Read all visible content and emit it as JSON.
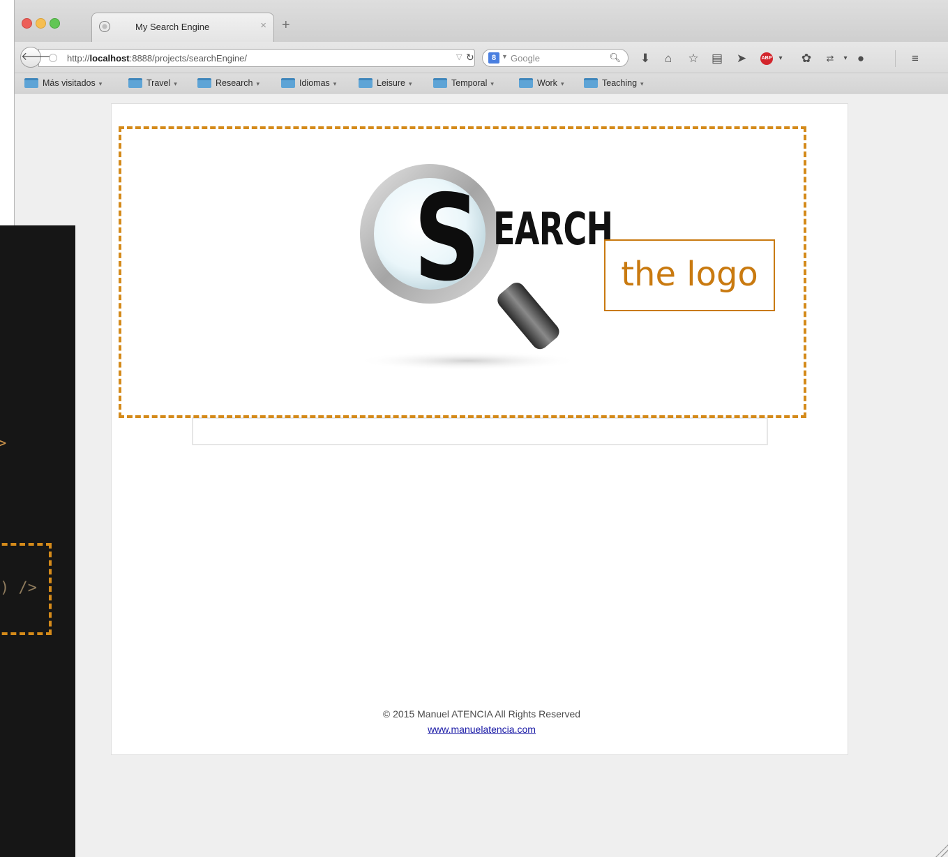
{
  "browser": {
    "tab_title": "My Search Engine",
    "tab_close": "×",
    "new_tab": "+",
    "url_prefix": "http://",
    "url_host": "localhost",
    "url_path": ":8888/projects/searchEngine/",
    "search_engine": "Google",
    "bookmarks": [
      {
        "label": "Más visitados"
      },
      {
        "label": "Travel"
      },
      {
        "label": "Research"
      },
      {
        "label": "Idiomas"
      },
      {
        "label": "Leisure"
      },
      {
        "label": "Temporal"
      },
      {
        "label": "Work"
      },
      {
        "label": "Teaching"
      }
    ]
  },
  "page": {
    "logo_text": "EARCH",
    "logo_initial": "S",
    "callout_label": "the logo",
    "search_query": "",
    "footer_copyright": "© 2015 Manuel ATENCIA All Rights Reserved",
    "footer_link": "www.manuelatencia.com"
  },
  "editor": {
    "fragment_top": ">",
    "fragment_tag": ") />"
  },
  "colors": {
    "annotation_orange": "#d48a1a",
    "editor_bg": "#161616",
    "page_bg": "#ffffff",
    "chrome_bg": "#efefef"
  }
}
